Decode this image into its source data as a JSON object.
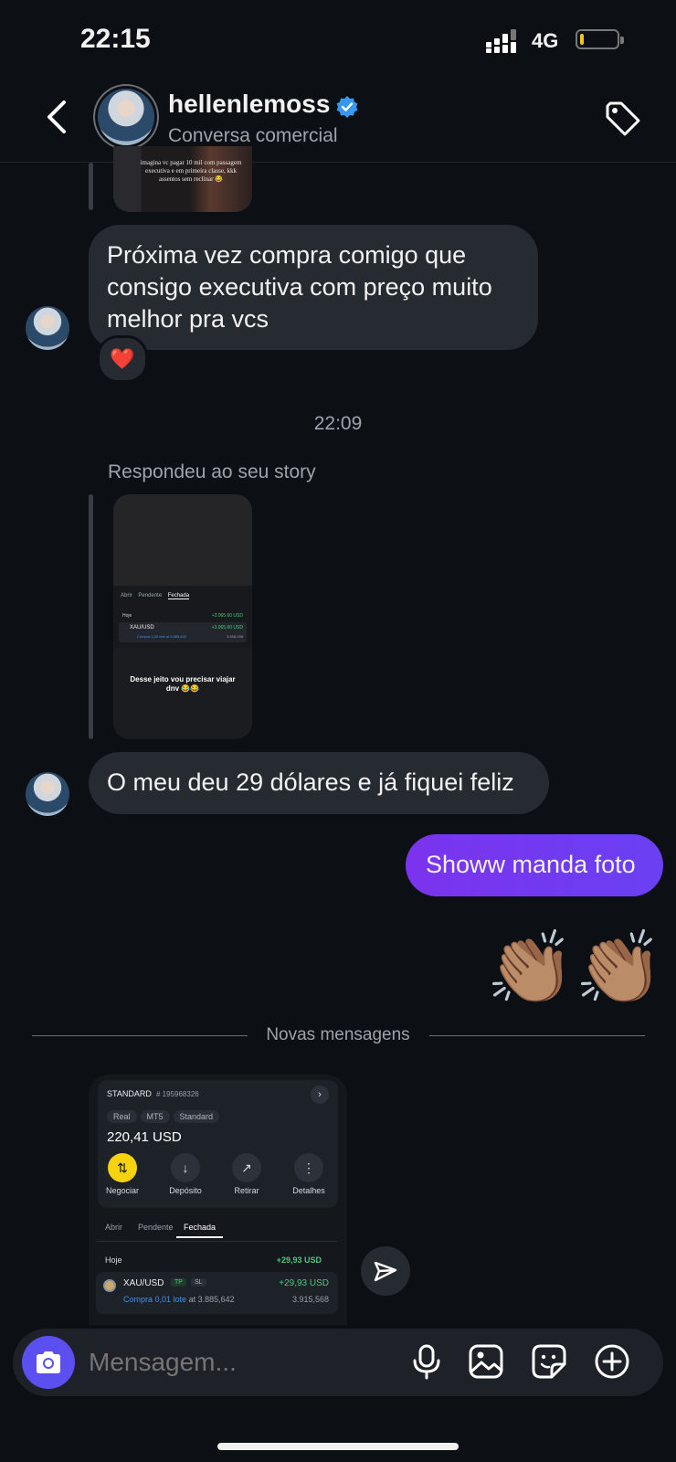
{
  "status_bar": {
    "time": "22:15",
    "network": "4G",
    "battery_level": 0.08
  },
  "header": {
    "username": "hellenlemoss",
    "verified": true,
    "subtitle": "Conversa comercial"
  },
  "colors": {
    "sent_bubble": "#6b3af0",
    "received_bubble": "#262a31",
    "background": "#0c0f14",
    "verified": "#3897f0"
  },
  "top_thumbnail": {
    "caption": "imagina vc pagar 10 mil com passagem executiva e em primeira classe, kkk assentos sem reclinar 😂"
  },
  "messages": {
    "m1": {
      "text": "Próxima vez compra comigo que consigo executiva com preço muito melhor pra vcs",
      "reaction": "❤️"
    },
    "timestamp": "22:09",
    "story_reply_label": "Respondeu ao seu story",
    "story": {
      "tabs": [
        "Abrir",
        "Pendente",
        "Fechada"
      ],
      "today": "Hoje",
      "today_value": "+3.065,60 USD",
      "pair": "XAU/USD",
      "pair_value": "+3.065,60 USD",
      "detail": "Compra 1,00 lote at 3.885,642",
      "detail_price": "3.916,198",
      "caption": "Desse jeito vou precisar viajar dnv 😂😂"
    },
    "m2": {
      "text": "O meu deu 29 dólares e já fiquei feliz"
    },
    "m3": {
      "text": "Showw manda foto"
    },
    "m4": {
      "emoji": "👏🏽👏🏽"
    }
  },
  "divider": "Novas mensagens",
  "screenshot_card": {
    "account": "STANDARD",
    "account_id": "# 195968326",
    "chips": [
      "Real",
      "MT5",
      "Standard"
    ],
    "balance": "220,41 USD",
    "actions": [
      "Negociar",
      "Depósito",
      "Retirar",
      "Detalhes"
    ],
    "tabs": [
      "Abrir",
      "Pendente",
      "Fechada"
    ],
    "today": "Hoje",
    "today_value": "+29,93 USD",
    "pair": "XAU/USD",
    "tp": "TP",
    "sl": "SL",
    "pair_value": "+29,93 USD",
    "detail_prefix": "Compra 0,01 lote",
    "detail_at": "at 3.885,642",
    "close_price": "3.915,568"
  },
  "composer": {
    "placeholder": "Mensagem..."
  },
  "icons": [
    "back-icon",
    "tag-icon",
    "verified-badge-icon",
    "share-icon",
    "camera-icon",
    "mic-icon",
    "gallery-icon",
    "sticker-icon",
    "plus-icon"
  ]
}
